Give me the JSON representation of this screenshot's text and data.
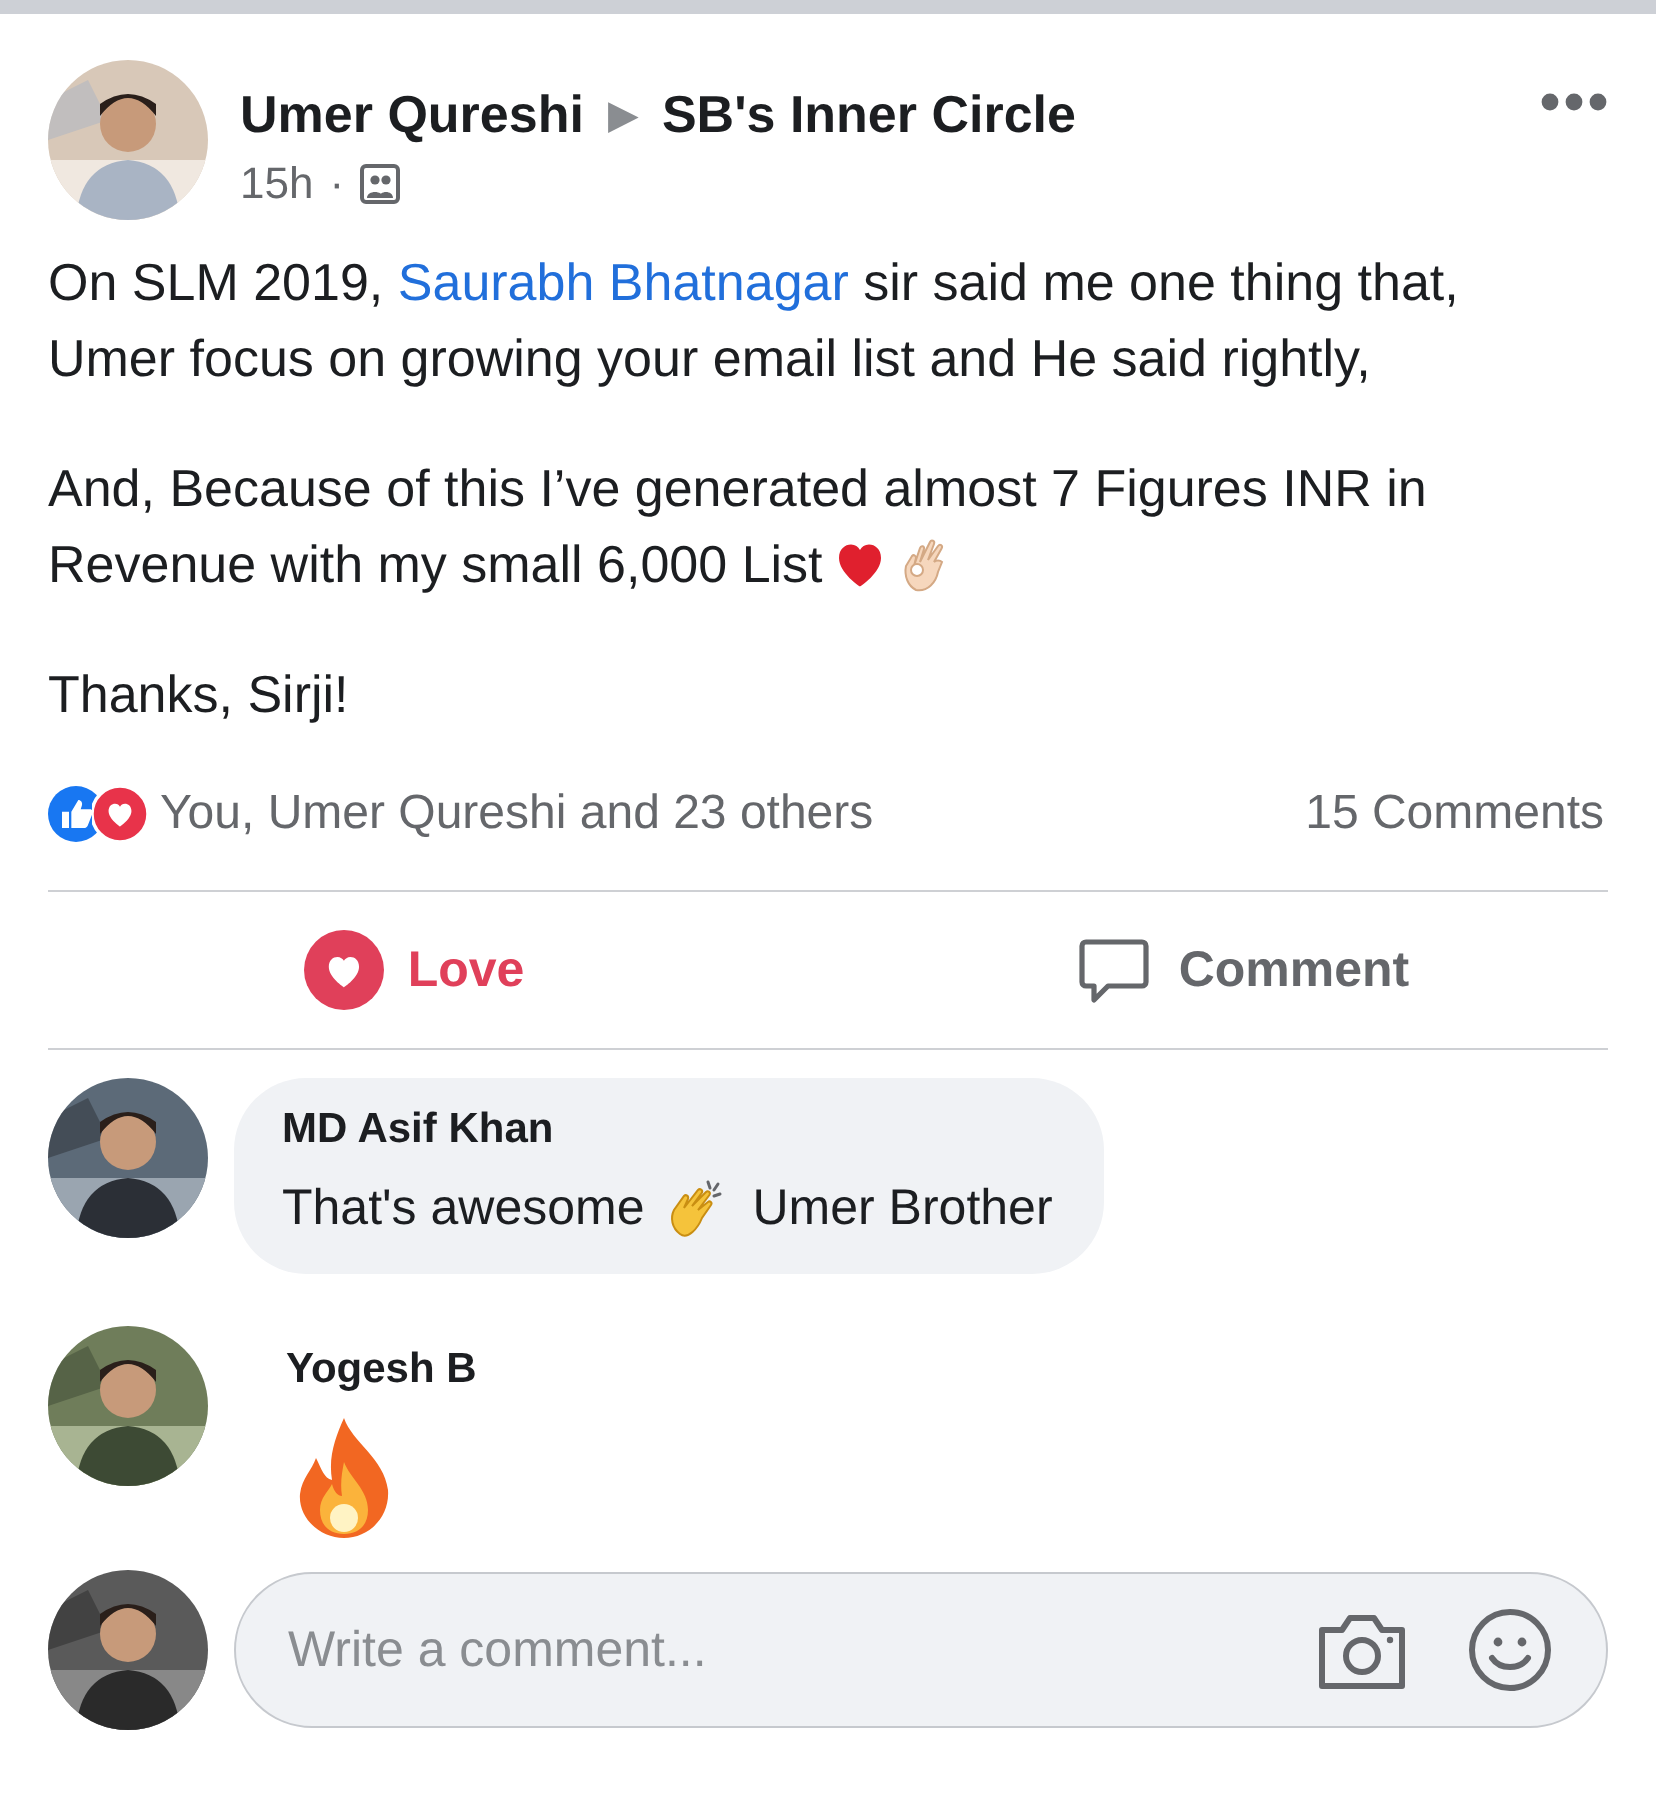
{
  "post": {
    "author": "Umer Qureshi",
    "separator": "▶",
    "group": "SB's Inner Circle",
    "time": "15h",
    "dot": "·",
    "paragraphs": [
      {
        "before": "On SLM 2019, ",
        "link": "Saurabh Bhatnagar",
        "after": " sir said me one thing that, Umer focus on growing your email list and He said rightly,"
      },
      {
        "lines": [
          "And, Because of this I’ve generated almost 7 Figures INR in",
          "Revenue with my small 6,000 List"
        ]
      },
      {
        "before": "Thanks, Sirji!"
      }
    ],
    "reactions_summary": "You, Umer Qureshi and 23 others",
    "comments_count": "15 Comments"
  },
  "actions": [
    {
      "kind": "love",
      "label": "Love",
      "selected": true
    },
    {
      "kind": "comment",
      "label": "Comment",
      "selected": false
    }
  ],
  "comments": [
    {
      "author": "MD Asif Khan",
      "kind": "text",
      "text_parts": [
        "That's awesome",
        "Umer Brother"
      ]
    },
    {
      "author": "Yogesh B",
      "kind": "emoji"
    }
  ],
  "composer": {
    "placeholder": "Write a comment..."
  }
}
